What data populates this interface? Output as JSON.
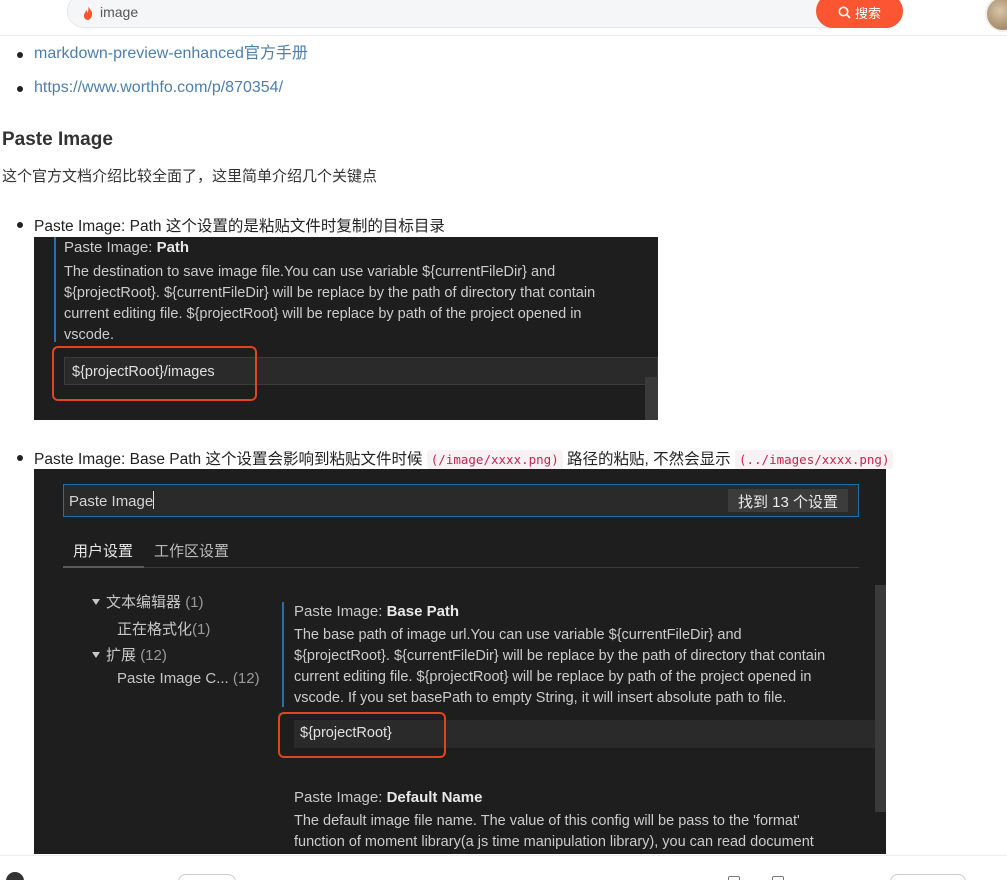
{
  "search": {
    "value": "image",
    "button_label": "搜索"
  },
  "links": [
    "markdown-preview-enhanced官方手册",
    "https://www.worthfo.com/p/870354/"
  ],
  "article": {
    "heading": "Paste Image",
    "intro": "这个官方文档介绍比较全面了，这里简单介绍几个关键点",
    "bullet1": "Paste Image: Path 这个设置的是粘贴文件时复制的目标目录",
    "bullet2_prefix": "Paste Image: Base Path 这个设置会影响到粘贴文件时候",
    "bullet2_code1": "(/image/xxxx.png)",
    "bullet2_mid": "路径的粘贴, 不然会显示",
    "bullet2_code2": "(../images/xxxx.png)"
  },
  "shot1": {
    "title_prefix": "Paste Image: ",
    "title_bold": "Path",
    "desc_lines": [
      "The destination to save image file.You can use variable ${currentFileDir} and",
      "${projectRoot}. ${currentFileDir} will be replace by the path of directory that contain",
      "current editing file. ${projectRoot} will be replace by path of the project opened in",
      "vscode."
    ],
    "input_value": "${projectRoot}/images"
  },
  "shot2": {
    "search_value": "Paste Image",
    "found_label": "找到 13 个设置",
    "tabs": [
      "用户设置",
      "工作区设置"
    ],
    "tree": [
      {
        "label": "文本编辑器",
        "count": "(1)",
        "expanded": true
      },
      {
        "label": "正在格式化",
        "count": "(1)"
      },
      {
        "label": "扩展",
        "count": "(12)",
        "expanded": true
      },
      {
        "label": "Paste Image C...",
        "count": "(12)"
      }
    ],
    "base_path": {
      "title_prefix": "Paste Image: ",
      "title_bold": "Base Path",
      "desc_lines": [
        "The base path of image url.You can use variable ${currentFileDir} and",
        "${projectRoot}. ${currentFileDir} will be replace by the path of directory that contain",
        "current editing file. ${projectRoot} will be replace by path of the project opened in",
        "vscode. If you set basePath to empty String, it will insert absolute path to file."
      ],
      "input_value": "${projectRoot}"
    },
    "default_name": {
      "title_prefix": "Paste Image: ",
      "title_bold": "Default Name",
      "desc_lines": [
        "The default image file name. The value of this config will be pass to the 'format'",
        "function of moment library(a js time manipulation library), you can read document"
      ]
    }
  },
  "colors": {
    "accent": "#fc5531",
    "link": "#4d7fae",
    "highlight": "#e0451e",
    "dark_bg": "#1e1e1e"
  }
}
